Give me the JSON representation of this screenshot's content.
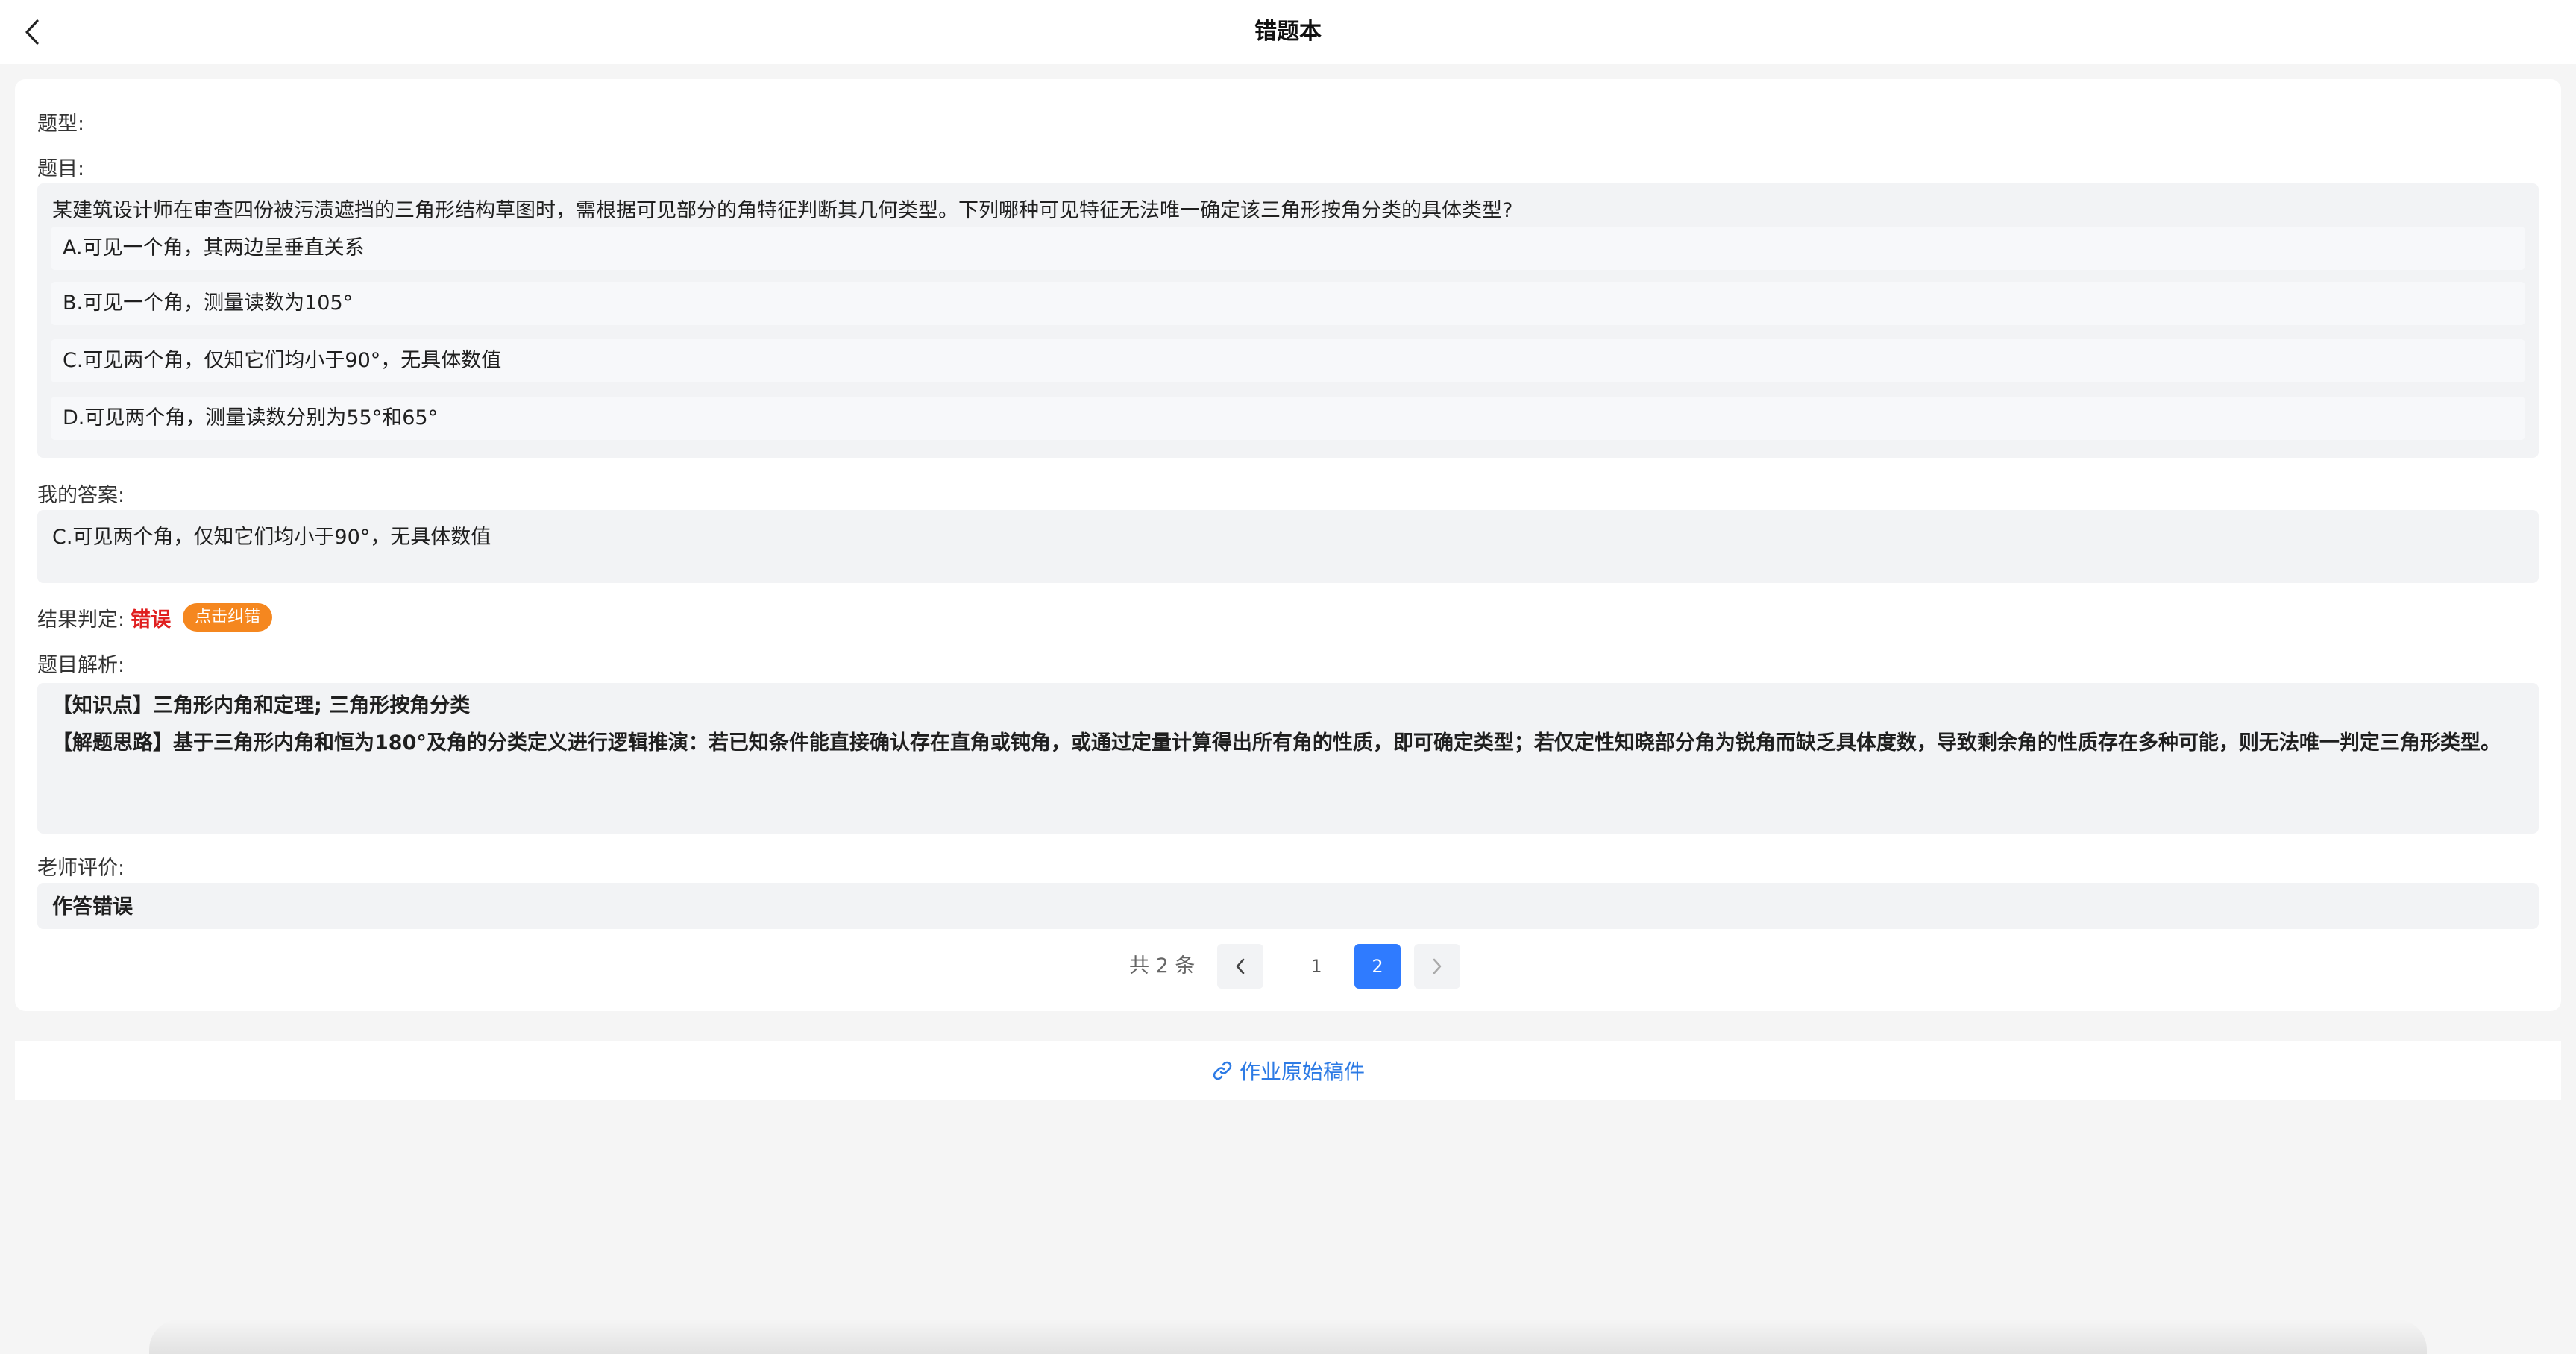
{
  "header": {
    "title": "错题本"
  },
  "question": {
    "type_label": "题型:",
    "type_value": "",
    "stem_label": "题目:",
    "stem_text": "某建筑设计师在审查四份被污渍遮挡的三角形结构草图时，需根据可见部分的角特征判断其几何类型。下列哪种可见特征无法唯一确定该三角形按角分类的具体类型?",
    "options": [
      {
        "label": "A.可见一个角，其两边呈垂直关系"
      },
      {
        "label": "B.可见一个角，测量读数为105°"
      },
      {
        "label": "C.可见两个角，仅知它们均小于90°，无具体数值"
      },
      {
        "label": "D.可见两个角，测量读数分别为55°和65°"
      }
    ]
  },
  "my_answer": {
    "label": "我的答案:",
    "value": "C.可见两个角，仅知它们均小于90°，无具体数值"
  },
  "result": {
    "label": "结果判定:",
    "value": "错误",
    "correct_button": "点击纠错",
    "value_color": "#e02020",
    "button_color": "#f5871f"
  },
  "analysis": {
    "label": "题目解析:",
    "knowledge": "【知识点】三角形内角和定理; 三角形按角分类",
    "approach": "【解题思路】基于三角形内角和恒为180°及角的分类定义进行逻辑推演：若已知条件能直接确认存在直角或钝角，或通过定量计算得出所有角的性质，即可确定类型；若仅定性知晓部分角为锐角而缺乏具体度数，导致剩余角的性质存在多种可能，则无法唯一判定三角形类型。"
  },
  "teacher": {
    "label": "老师评价:",
    "comment": "作答错误"
  },
  "pagination": {
    "total": "共 2 条",
    "pages": [
      "1",
      "2"
    ],
    "current": "2",
    "active_color": "#2f7bff"
  },
  "footer": {
    "link_label": "作业原始稿件",
    "link_icon": "link-icon",
    "link_color": "#2d7be5"
  }
}
